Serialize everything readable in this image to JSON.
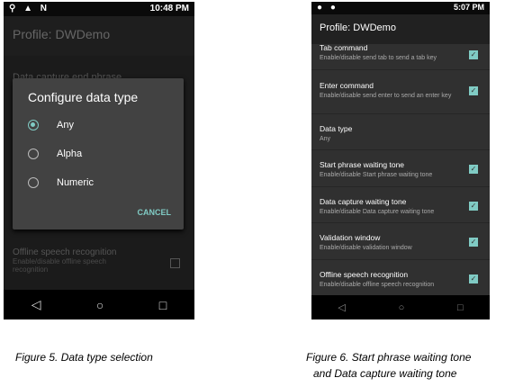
{
  "left": {
    "status_icons": "⚲ ▲ N",
    "time": "10:48 PM",
    "title": "Profile: DWDemo",
    "bg_item": "Data capture end phrase",
    "dialog": {
      "title": "Configure data type",
      "options": [
        "Any",
        "Alpha",
        "Numeric"
      ],
      "selected": "Any",
      "cancel": "CANCEL"
    },
    "bottom_item": {
      "title": "Offline speech recognition",
      "subtitle": "Enable/disable offline speech recognition",
      "checked": false
    }
  },
  "right": {
    "time": "5:07 PM",
    "title": "Profile: DWDemo",
    "items": [
      {
        "title": "Tab command",
        "subtitle": "Enable/disable send tab to send a tab key",
        "checked": true
      },
      {
        "title": "Enter command",
        "subtitle": "Enable/disable send enter to send an enter key",
        "checked": true
      },
      {
        "title": "Data type",
        "subtitle": "Any"
      },
      {
        "title": "Start phrase waiting tone",
        "subtitle": "Enable/disable Start phrase waiting tone",
        "checked": true
      },
      {
        "title": "Data capture waiting tone",
        "subtitle": "Enable/disable Data capture waiting tone",
        "checked": true
      },
      {
        "title": "Validation window",
        "subtitle": "Enable/disable validation window",
        "checked": true
      },
      {
        "title": "Offline speech recognition",
        "subtitle": "Enable/disable offline speech recognition",
        "checked": true
      }
    ]
  },
  "captions": {
    "fig5": "Figure 5. Data type selection",
    "fig6_line1": "Figure 6. Start phrase waiting tone",
    "fig6_line2": "and Data capture waiting tone"
  },
  "accent": "#80cbc4"
}
